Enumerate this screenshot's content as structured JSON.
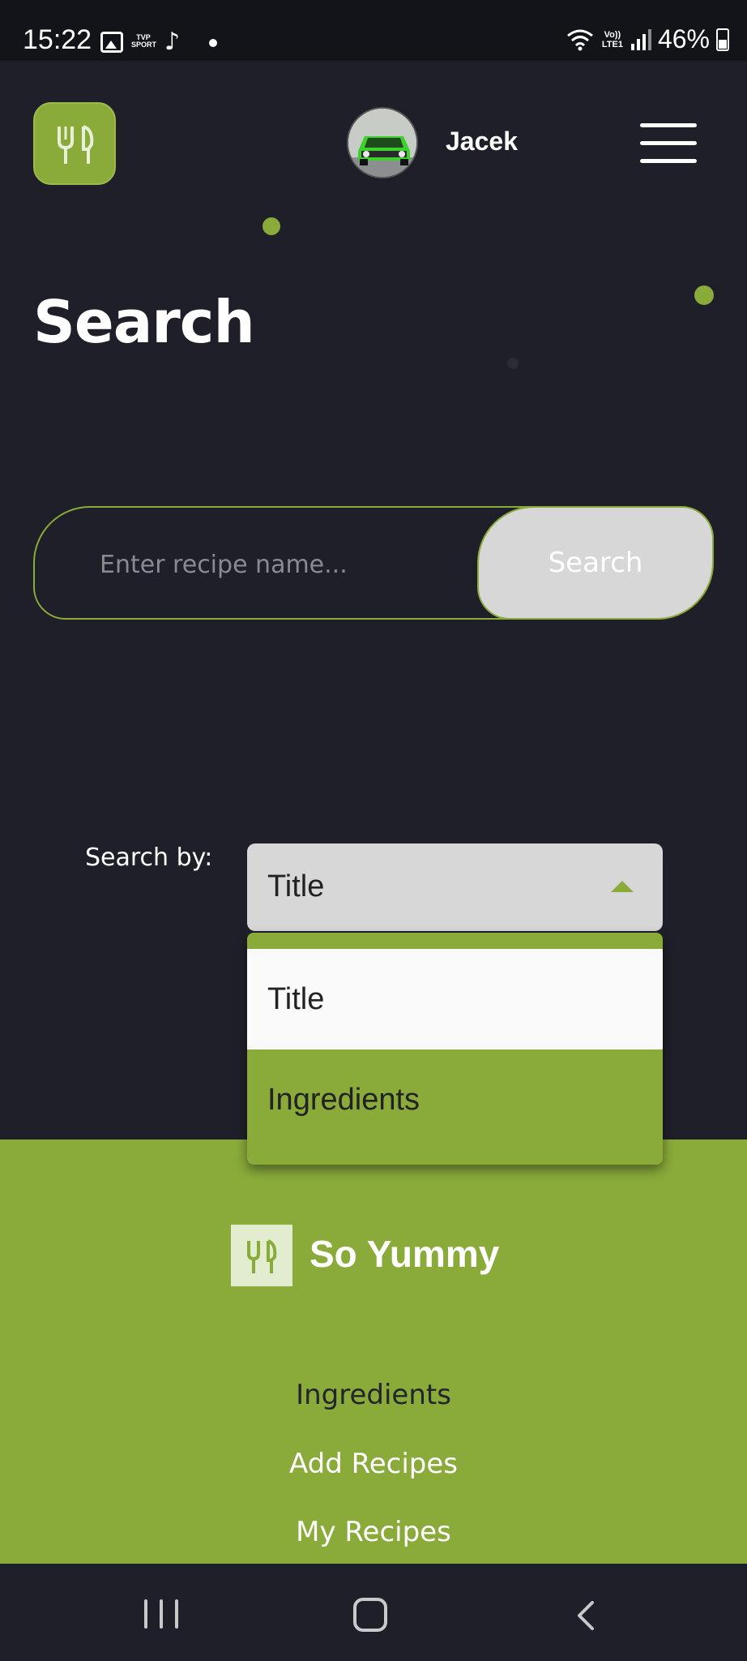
{
  "status_bar": {
    "time": "15:22",
    "tvp_label": "TVP SPORT",
    "network_label": "Vo)) LTE1",
    "battery": "46%"
  },
  "header": {
    "username": "Jacek",
    "logo_icon": "cutlery-icon",
    "menu_icon": "hamburger-menu-icon"
  },
  "page": {
    "title": "Search"
  },
  "search": {
    "placeholder": "Enter recipe name...",
    "button_label": "Search"
  },
  "search_by": {
    "label": "Search by:",
    "selected": "Title",
    "options": [
      "Title",
      "Ingredients"
    ]
  },
  "footer": {
    "brand": "So Yummy",
    "links": [
      "Ingredients",
      "Add Recipes",
      "My Recipes"
    ]
  },
  "colors": {
    "accent": "#8aaa3a",
    "background": "#1e1f28",
    "button_gray": "#d7d7d7"
  }
}
